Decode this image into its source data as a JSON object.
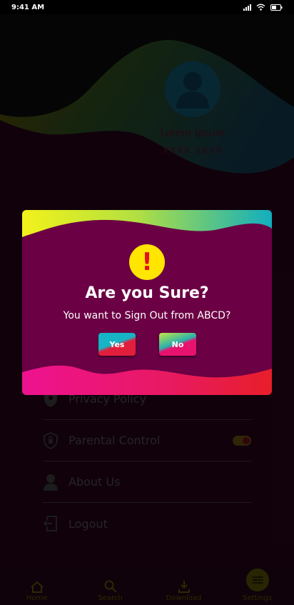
{
  "status_bar": {
    "time": "9:41 AM"
  },
  "profile": {
    "name": "Lorem Ipsum",
    "id": "XXXX XXXX"
  },
  "menu": {
    "items": [
      {
        "label": "Privacy Policy",
        "icon": "shield-location-icon"
      },
      {
        "label": "Parental Control",
        "icon": "shield-lock-icon",
        "toggle_on": true
      },
      {
        "label": "About Us",
        "icon": "person-icon"
      },
      {
        "label": "Logout",
        "icon": "logout-icon"
      }
    ]
  },
  "bottom_nav": {
    "items": [
      {
        "label": "Home",
        "icon": "home-icon"
      },
      {
        "label": "Search",
        "icon": "search-icon"
      },
      {
        "label": "Download",
        "icon": "download-icon"
      },
      {
        "label": "Settings",
        "icon": "settings-icon",
        "active": true
      }
    ]
  },
  "dialog": {
    "icon": "alert-icon",
    "icon_glyph": "!",
    "title": "Are you Sure?",
    "message": "You want to Sign Out from ABCD?",
    "yes_label": "Yes",
    "no_label": "No"
  },
  "colors": {
    "dialog_bg": "#6b0044",
    "alert_yellow": "#ffe500",
    "alert_red": "#e0121e",
    "accent_pink": "#e6126e",
    "accent_teal": "#17b4c6"
  }
}
